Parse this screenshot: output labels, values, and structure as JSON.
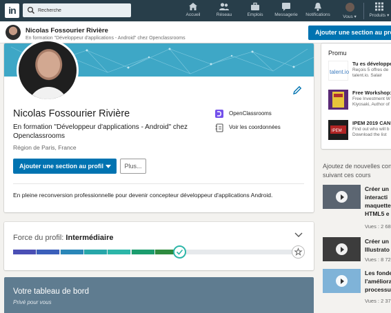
{
  "nav": {
    "logo": "in",
    "search_placeholder": "Recherche",
    "items": [
      {
        "label": "Accueil",
        "icon": "home-icon"
      },
      {
        "label": "Réseau",
        "icon": "network-icon"
      },
      {
        "label": "Emplois",
        "icon": "briefcase-icon"
      },
      {
        "label": "Messagerie",
        "icon": "messaging-icon"
      },
      {
        "label": "Notifications",
        "icon": "bell-icon"
      },
      {
        "label": "Vous ▾",
        "icon": "me-avatar"
      },
      {
        "label": "Produits ▾",
        "icon": "grid-icon"
      }
    ]
  },
  "sticky": {
    "name": "Nicolas Fossourier Rivière",
    "headline": "En formation \"Développeur d'applications - Android\" chez Openclassrooms",
    "cta": "Ajouter une section au profil"
  },
  "profile": {
    "name": "Nicolas Fossourier Rivière",
    "headline": "En formation \"Développeur d'applications - Android\" chez Openclassrooms",
    "location": "Région de Paris, France",
    "add_section": "Ajouter une section au profil",
    "more": "Plus...",
    "school": "OpenClassrooms",
    "contact": "Voir les coordonnées",
    "summary": "En pleine reconversion professionnelle pour devenir concepteur développeur d'applications Android."
  },
  "strength": {
    "label": "Force du profil: ",
    "level": "Intermédiaire",
    "progress": 0.57
  },
  "dashboard": {
    "title": "Votre tableau de bord",
    "subtitle": "Privé pour vous"
  },
  "promo": {
    "header": "Promu",
    "items": [
      {
        "title": "Tu es développe",
        "desc1": "Reçois 5 offres de ",
        "desc2": "talent.io. Salair"
      },
      {
        "title": "Free Workshop:",
        "desc1": "Free Investment W",
        "desc2": "Kiyosaki, Author of"
      },
      {
        "title": "IPEM 2019 CAN",
        "desc1": "Find out who will b",
        "desc2": "Download the list"
      }
    ]
  },
  "courses": {
    "header": "Ajoutez de nouvelles con suivant ces cours",
    "items": [
      {
        "title": "Créer un interacti maquette HTML5 e",
        "views": "Vues : 2 68"
      },
      {
        "title": "Créer un Illustrato",
        "views": "Vues : 8 72"
      },
      {
        "title": "Les fonde l'améliora processu",
        "views": "Vues : 2 37"
      }
    ]
  },
  "colors": {
    "nav_bg": "#283e4a",
    "primary": "#0073b1",
    "banner": "#3ea7c6",
    "meter": [
      "#4a4fb5",
      "#3b5fba",
      "#2a86b8",
      "#27a6a9",
      "#2cb6a8",
      "#1b9d6e",
      "#2e8b3f"
    ]
  }
}
